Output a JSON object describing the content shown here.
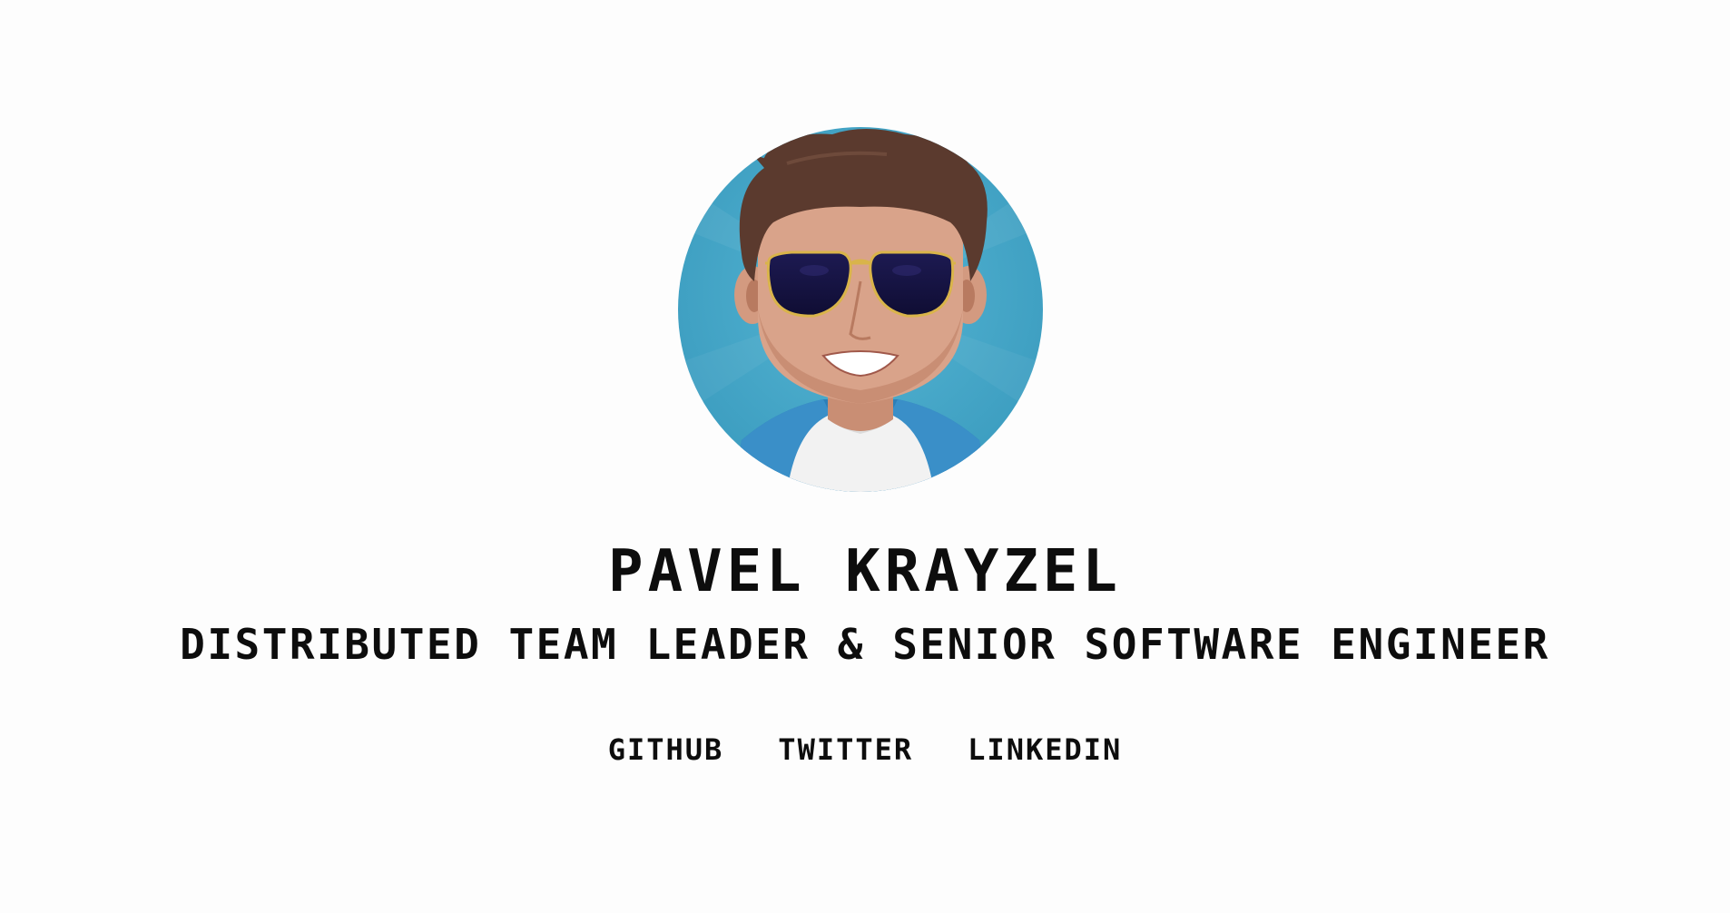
{
  "profile": {
    "avatar_alt": "avatar",
    "name": "PAVEL KRAYZEL",
    "role": "DISTRIBUTED TEAM LEADER & SENIOR SOFTWARE ENGINEER"
  },
  "links": [
    {
      "label": "GITHUB"
    },
    {
      "label": "TWITTER"
    },
    {
      "label": "LINKEDIN"
    }
  ],
  "colors": {
    "background": "#fdfdfd",
    "text": "#0d0d0d",
    "avatar_bg": "#4aa8c8"
  }
}
